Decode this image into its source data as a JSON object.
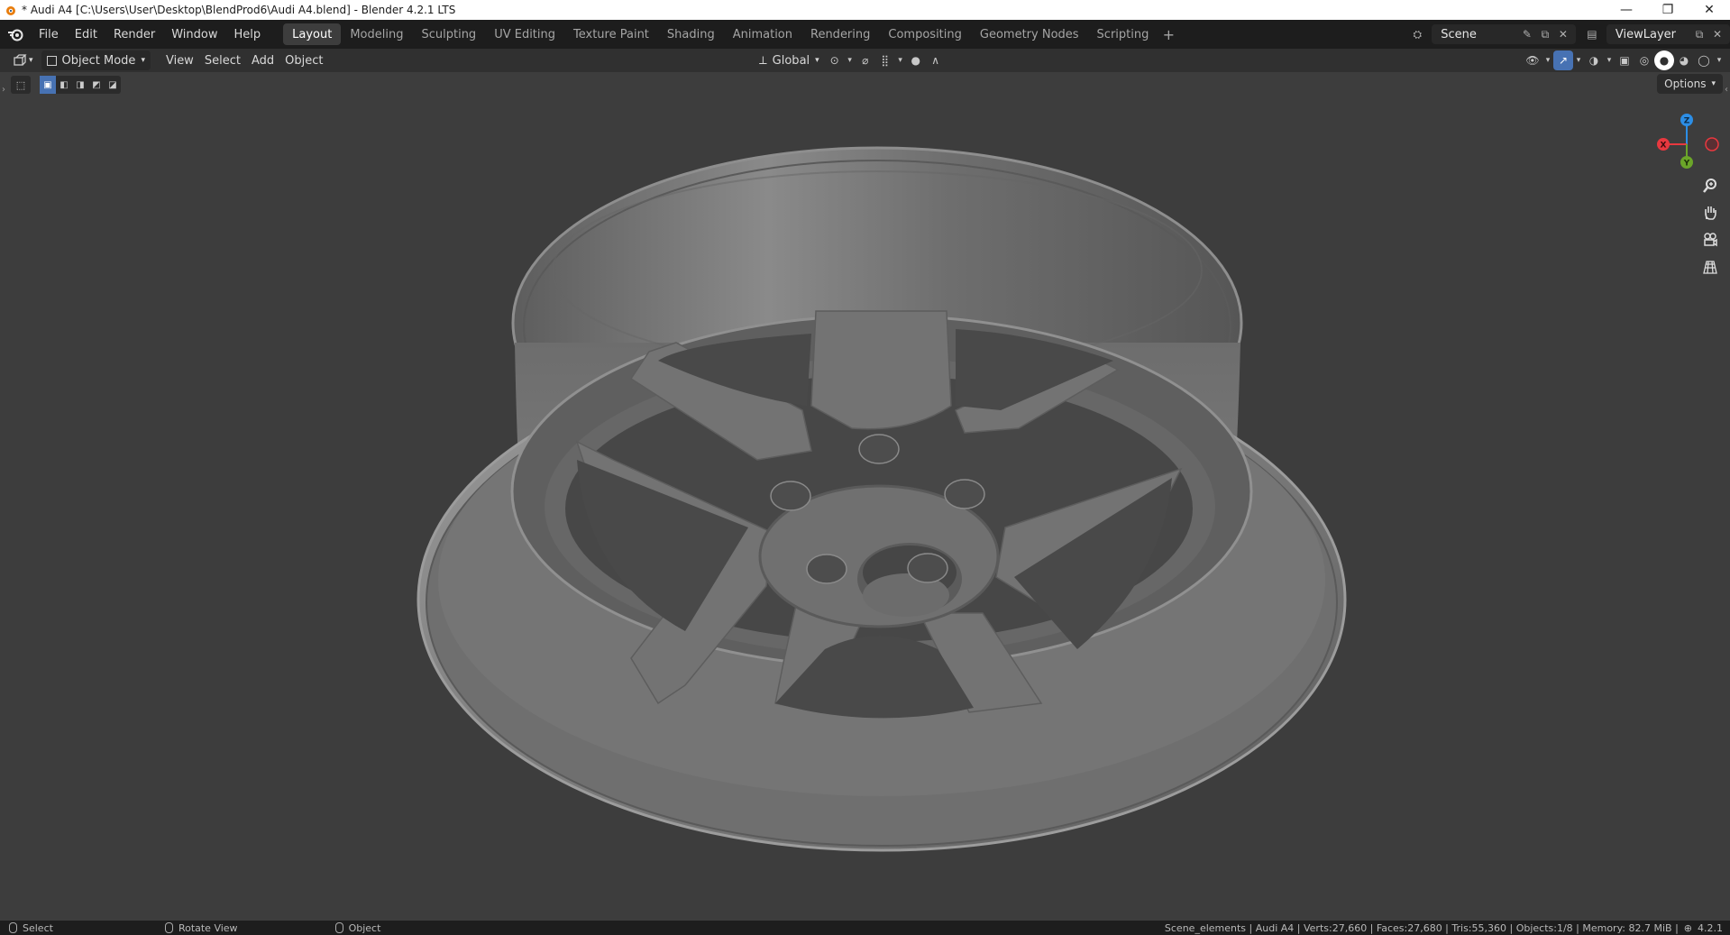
{
  "window": {
    "title": "* Audi A4 [C:\\Users\\User\\Desktop\\BlendProd6\\Audi A4.blend] - Blender 4.2.1 LTS",
    "minimize": "—",
    "restore": "❐",
    "close": "✕"
  },
  "menu": {
    "items": [
      "File",
      "Edit",
      "Render",
      "Window",
      "Help"
    ]
  },
  "workspaces": {
    "tabs": [
      "Layout",
      "Modeling",
      "Sculpting",
      "UV Editing",
      "Texture Paint",
      "Shading",
      "Animation",
      "Rendering",
      "Compositing",
      "Geometry Nodes",
      "Scripting"
    ],
    "active": "Layout",
    "add": "+"
  },
  "scene": {
    "name": "Scene",
    "view_layer": "ViewLayer"
  },
  "viewport_header": {
    "mode": "Object Mode",
    "menus": [
      "View",
      "Select",
      "Add",
      "Object"
    ],
    "transform_orientation": "Global"
  },
  "viewport": {
    "options_label": "Options",
    "axes": {
      "x": "X",
      "y": "Y",
      "z": "Z"
    },
    "colors": {
      "x": "#e8383f",
      "y": "#6ba529",
      "z": "#2c8ee6",
      "background": "#3d3d3d"
    }
  },
  "statusbar": {
    "left": [
      {
        "label": "Select"
      },
      {
        "label": "Rotate View"
      },
      {
        "label": "Object"
      }
    ],
    "stats": "Scene_elements | Audi A4 | Verts:27,660 | Faces:27,680 | Tris:55,360 | Objects:1/8 | Memory: 82.7 MiB |",
    "version": "4.2.1"
  }
}
